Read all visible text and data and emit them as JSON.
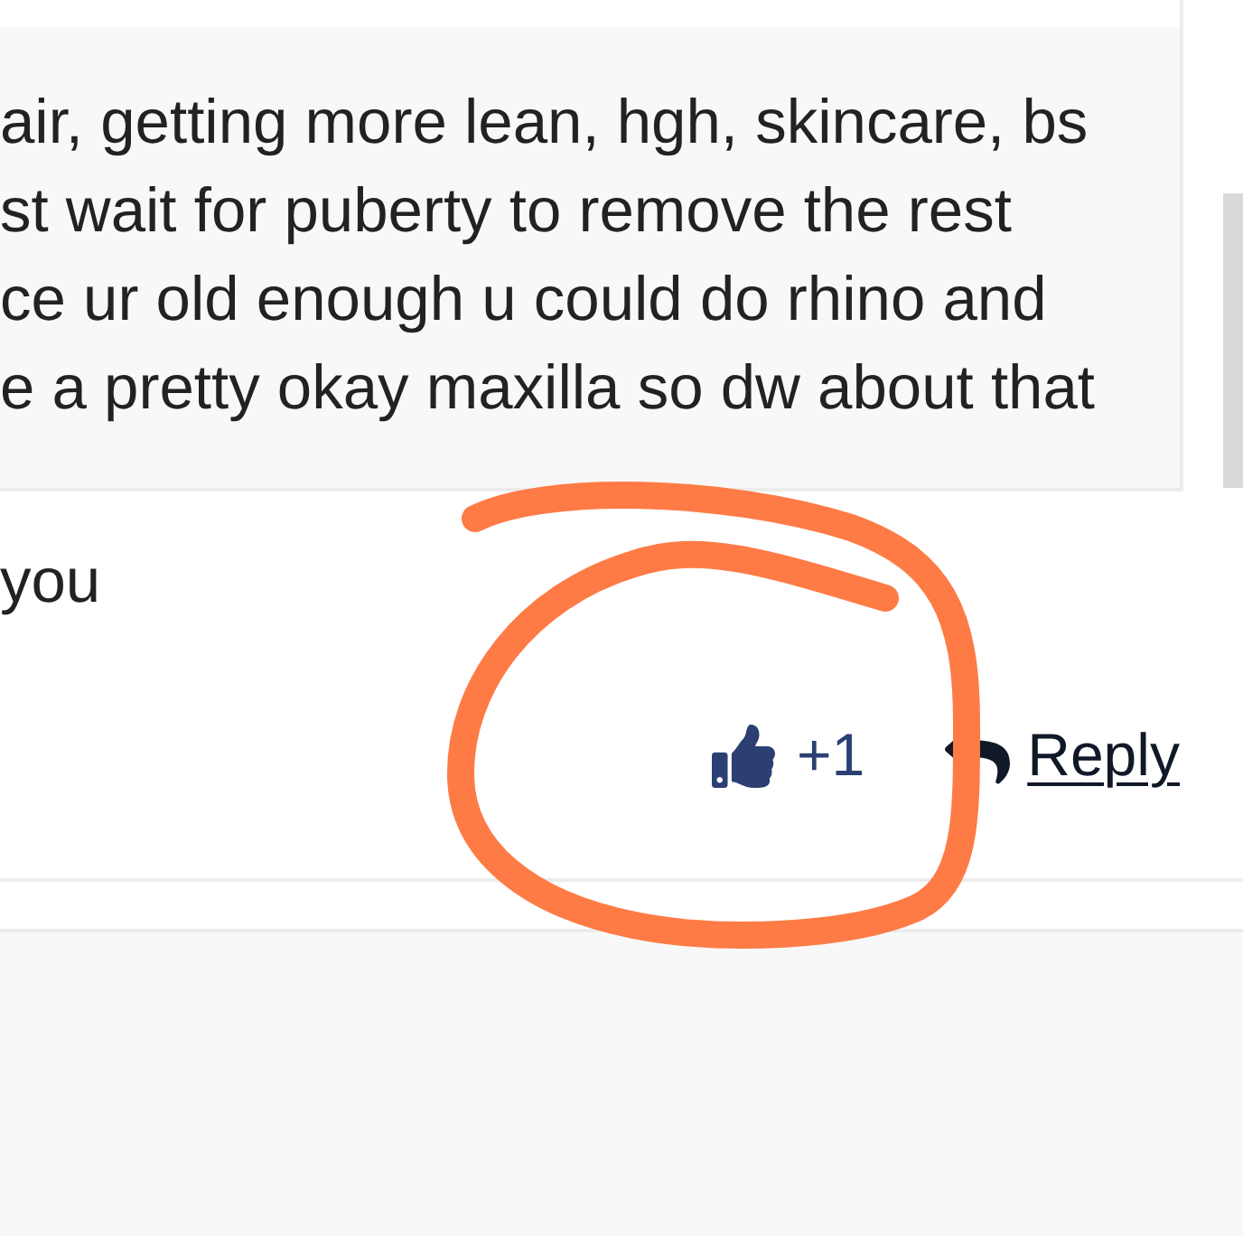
{
  "quote": {
    "lines": [
      "air, getting more lean, hgh, skincare, bs",
      "st wait for puberty to remove the rest",
      "ce ur old enough u could do rhino and",
      "e a pretty okay maxilla so dw about that"
    ]
  },
  "post": {
    "text": "you"
  },
  "actions": {
    "like_count": "+1",
    "reply_label": "Reply"
  }
}
